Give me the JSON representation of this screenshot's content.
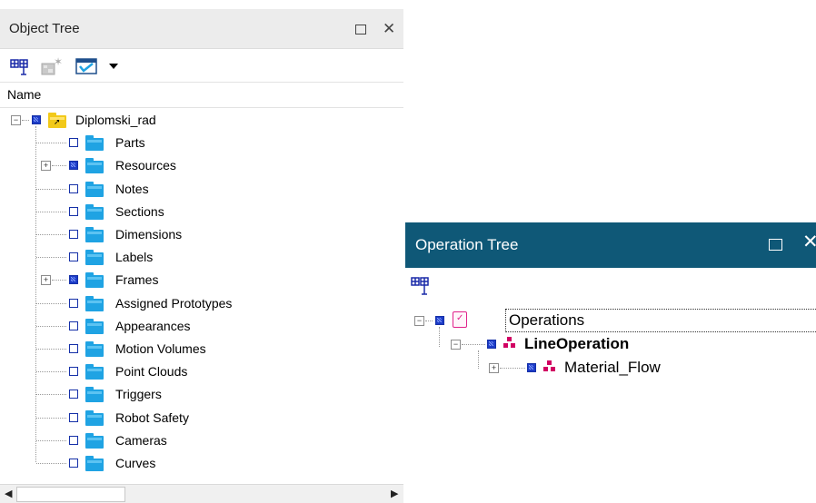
{
  "object_tree": {
    "title": "Object Tree",
    "column_header": "Name",
    "root": {
      "label": "Diplomski_rad",
      "expanded": true
    },
    "items": [
      {
        "label": "Parts",
        "expandable": false,
        "partial": false
      },
      {
        "label": "Resources",
        "expandable": true,
        "partial": true
      },
      {
        "label": "Notes",
        "expandable": false,
        "partial": false
      },
      {
        "label": "Sections",
        "expandable": false,
        "partial": false
      },
      {
        "label": "Dimensions",
        "expandable": false,
        "partial": false
      },
      {
        "label": "Labels",
        "expandable": false,
        "partial": false
      },
      {
        "label": "Frames",
        "expandable": true,
        "partial": true
      },
      {
        "label": "Assigned Prototypes",
        "expandable": false,
        "partial": false
      },
      {
        "label": "Appearances",
        "expandable": false,
        "partial": false
      },
      {
        "label": "Motion Volumes",
        "expandable": false,
        "partial": false
      },
      {
        "label": "Point Clouds",
        "expandable": false,
        "partial": false
      },
      {
        "label": "Triggers",
        "expandable": false,
        "partial": false
      },
      {
        "label": "Robot Safety",
        "expandable": false,
        "partial": false
      },
      {
        "label": "Cameras",
        "expandable": false,
        "partial": false
      },
      {
        "label": "Curves",
        "expandable": false,
        "partial": false
      }
    ],
    "toolbar_icons": [
      "tree-filter-icon",
      "new-object-icon",
      "display-filter-icon",
      "dropdown-arrow-icon"
    ]
  },
  "operation_tree": {
    "title": "Operation Tree",
    "root": {
      "label": "Operations",
      "expanded": true
    },
    "items": [
      {
        "label": "LineOperation",
        "bold": true,
        "expanded": true
      },
      {
        "label": "Material_Flow",
        "bold": false,
        "expanded": false
      }
    ],
    "toolbar_icons": [
      "tree-filter-icon"
    ]
  },
  "colors": {
    "object_title_bg": "#ececec",
    "operation_title_bg": "#0f5877",
    "folder": "#1fa3e3",
    "root_folder": "#f2c919",
    "checkbox": "#1530a8",
    "operation_icon": "#d10062"
  }
}
